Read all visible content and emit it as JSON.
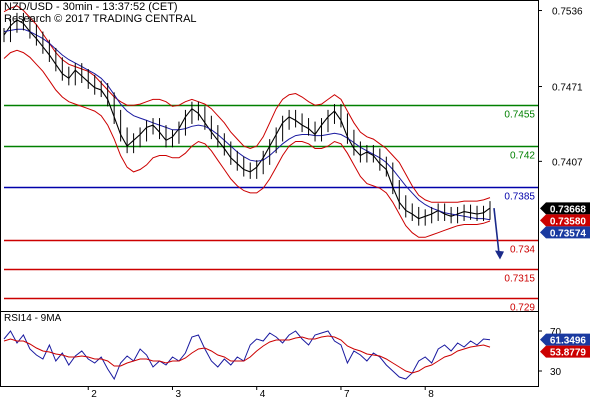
{
  "header": {
    "title": "NZD/USD - 30min - 13:37:52 (CET)",
    "subtitle": "Research © 2017 TRADING CENTRAL"
  },
  "colors": {
    "price": "#000000",
    "bollinger": "#cc0000",
    "moving_average": "#1a1aa0",
    "resistance": "#008000",
    "pivot": "#0000aa",
    "support": "#cc0000",
    "arrow": "#1a2a8a",
    "rsi": "#1a1aa0",
    "rsi_ma": "#cc0000",
    "badge_price": "#000000",
    "badge_red": "#cc0000",
    "badge_blue": "#1a3aa0"
  },
  "chart_data": [
    {
      "type": "line",
      "title": "NZD/USD - 30min - 13:37:52 (CET)",
      "x_tick_labels": [
        "2",
        "3",
        "4",
        "7",
        "8"
      ],
      "y_tick_labels": [
        "0.7536",
        "0.7471",
        "0.7407"
      ],
      "ylim": [
        0.7279,
        0.7545
      ],
      "grid": false,
      "series": [
        {
          "values": [
            0.7515,
            0.7523,
            0.7528,
            0.7525,
            0.7518,
            0.7512,
            0.7505,
            0.7498,
            0.749,
            0.7482,
            0.7478,
            0.7485,
            0.748,
            0.7475,
            0.747,
            0.7468,
            0.746,
            0.7445,
            0.743,
            0.742,
            0.7425,
            0.743,
            0.7436,
            0.7438,
            0.7432,
            0.7425,
            0.7428,
            0.7435,
            0.7445,
            0.7452,
            0.7448,
            0.744,
            0.7432,
            0.7425,
            0.7418,
            0.741,
            0.7405,
            0.74,
            0.7398,
            0.7402,
            0.741,
            0.742,
            0.743,
            0.744,
            0.7445,
            0.7442,
            0.7438,
            0.7435,
            0.743,
            0.7438,
            0.7445,
            0.745,
            0.7442,
            0.7428,
            0.7418,
            0.7412,
            0.7415,
            0.7412,
            0.7405,
            0.74,
            0.7385,
            0.7372,
            0.7365,
            0.7362,
            0.7358,
            0.736,
            0.7362,
            0.7365,
            0.7362,
            0.736,
            0.7362,
            0.7364,
            0.7363,
            0.7362,
            0.7363,
            0.7367
          ]
        },
        {
          "values": [
            0.7535,
            0.7538,
            0.754,
            0.7536,
            0.753,
            0.7524,
            0.7516,
            0.7508,
            0.75,
            0.7494,
            0.749,
            0.7488,
            0.7486,
            0.7484,
            0.748,
            0.7474,
            0.7468,
            0.7462,
            0.7458,
            0.7455,
            0.7455,
            0.7456,
            0.7458,
            0.746,
            0.746,
            0.7458,
            0.7454,
            0.7455,
            0.7458,
            0.746,
            0.7458,
            0.7456,
            0.7452,
            0.7446,
            0.744,
            0.7432,
            0.7426,
            0.742,
            0.7418,
            0.742,
            0.7428,
            0.744,
            0.7452,
            0.746,
            0.7464,
            0.7465,
            0.7462,
            0.7458,
            0.7455,
            0.7456,
            0.746,
            0.7464,
            0.746,
            0.745,
            0.744,
            0.7432,
            0.7428,
            0.7426,
            0.7422,
            0.7418,
            0.7412,
            0.7406,
            0.7396,
            0.7386,
            0.7378,
            0.7374,
            0.7372,
            0.7372,
            0.7372,
            0.7372,
            0.7372,
            0.7373,
            0.7373,
            0.7373,
            0.7374,
            0.7376
          ]
        },
        {
          "values": [
            0.7495,
            0.75,
            0.7502,
            0.75,
            0.7496,
            0.749,
            0.7484,
            0.7476,
            0.7468,
            0.7462,
            0.7458,
            0.7456,
            0.7454,
            0.7452,
            0.745,
            0.7446,
            0.7438,
            0.7426,
            0.7412,
            0.7402,
            0.7398,
            0.74,
            0.7404,
            0.741,
            0.7412,
            0.7412,
            0.741,
            0.741,
            0.7414,
            0.742,
            0.7424,
            0.7422,
            0.7416,
            0.7408,
            0.74,
            0.7392,
            0.7386,
            0.7382,
            0.738,
            0.738,
            0.7384,
            0.7392,
            0.7402,
            0.7412,
            0.742,
            0.7424,
            0.7424,
            0.7422,
            0.7418,
            0.7418,
            0.742,
            0.7424,
            0.7422,
            0.7414,
            0.7404,
            0.7394,
            0.7388,
            0.7386,
            0.7384,
            0.738,
            0.7372,
            0.7362,
            0.7352,
            0.7346,
            0.7342,
            0.7342,
            0.7344,
            0.7346,
            0.7348,
            0.735,
            0.7352,
            0.7353,
            0.7353,
            0.7353,
            0.7354,
            0.7356
          ]
        },
        {
          "values": [
            0.7518,
            0.7519,
            0.752,
            0.752,
            0.7518,
            0.7515,
            0.7512,
            0.7508,
            0.7503,
            0.7498,
            0.7494,
            0.7491,
            0.7488,
            0.7485,
            0.7482,
            0.7478,
            0.7472,
            0.7464,
            0.7456,
            0.745,
            0.7446,
            0.7444,
            0.7442,
            0.744,
            0.7438,
            0.7436,
            0.7434,
            0.7434,
            0.7435,
            0.7437,
            0.7438,
            0.7437,
            0.7434,
            0.743,
            0.7425,
            0.742,
            0.7415,
            0.7411,
            0.7408,
            0.7407,
            0.7408,
            0.7412,
            0.7417,
            0.7422,
            0.7426,
            0.7429,
            0.743,
            0.743,
            0.7429,
            0.7429,
            0.743,
            0.7431,
            0.743,
            0.7427,
            0.7423,
            0.7419,
            0.7416,
            0.7413,
            0.741,
            0.7406,
            0.74,
            0.7393,
            0.7386,
            0.738,
            0.7374,
            0.737,
            0.7367,
            0.7365,
            0.7363,
            0.7362,
            0.7361,
            0.736,
            0.7359,
            0.7358,
            0.7358,
            0.7357
          ]
        }
      ],
      "levels": [
        {
          "label": "0.7455",
          "value": 0.7455,
          "color": "#008000"
        },
        {
          "label": "0.742",
          "value": 0.742,
          "color": "#008000"
        },
        {
          "label": "0.7385",
          "value": 0.7385,
          "color": "#0000aa"
        },
        {
          "label": "0.734",
          "value": 0.734,
          "color": "#cc0000"
        },
        {
          "label": "0.7315",
          "value": 0.7315,
          "color": "#cc0000"
        },
        {
          "label": "0.729",
          "value": 0.729,
          "color": "#cc0000"
        }
      ],
      "price_badges": [
        {
          "label": "0.73668",
          "value": 0.73668,
          "color": "#000000"
        },
        {
          "label": "0.73580",
          "value": 0.7358,
          "color": "#cc0000"
        },
        {
          "label": "0.73574",
          "value": 0.73574,
          "color": "#1a3aa0"
        }
      ],
      "forecast_arrow": {
        "from": 0.7367,
        "to": 0.7323
      }
    },
    {
      "type": "line",
      "title": "RSI14 - 9MA",
      "y_tick_labels": [
        "70",
        "30"
      ],
      "ylim": [
        15,
        90
      ],
      "grid": false,
      "series": [
        {
          "values": [
            62,
            70,
            58,
            66,
            52,
            46,
            42,
            56,
            40,
            48,
            36,
            45,
            50,
            42,
            38,
            44,
            32,
            22,
            38,
            45,
            40,
            52,
            46,
            34,
            40,
            36,
            44,
            40,
            48,
            64,
            66,
            52,
            40,
            34,
            42,
            36,
            44,
            40,
            56,
            62,
            60,
            68,
            64,
            58,
            66,
            70,
            62,
            56,
            66,
            68,
            70,
            60,
            56,
            38,
            50,
            46,
            40,
            48,
            44,
            36,
            30,
            24,
            22,
            28,
            40,
            44,
            38,
            52,
            56,
            50,
            58,
            54,
            60,
            56,
            62,
            61.3496
          ]
        },
        {
          "values": [
            60,
            62,
            60,
            60,
            57,
            53,
            50,
            49,
            47,
            46,
            44,
            44,
            45,
            44,
            42,
            42,
            40,
            35,
            35,
            38,
            40,
            42,
            42,
            40,
            40,
            38,
            40,
            40,
            43,
            48,
            52,
            53,
            50,
            46,
            44,
            40,
            40,
            40,
            44,
            50,
            55,
            59,
            61,
            61,
            61,
            63,
            64,
            62,
            62,
            64,
            65,
            64,
            61,
            55,
            52,
            50,
            47,
            46,
            45,
            42,
            38,
            34,
            30,
            28,
            30,
            34,
            36,
            40,
            44,
            46,
            50,
            52,
            54,
            55,
            56,
            53.8779
          ]
        }
      ],
      "rsi_badges": [
        {
          "label": "61.3496",
          "value": 61.3496,
          "color": "#1a3aa0"
        },
        {
          "label": "53.8779",
          "value": 53.8779,
          "color": "#cc0000"
        }
      ]
    }
  ]
}
